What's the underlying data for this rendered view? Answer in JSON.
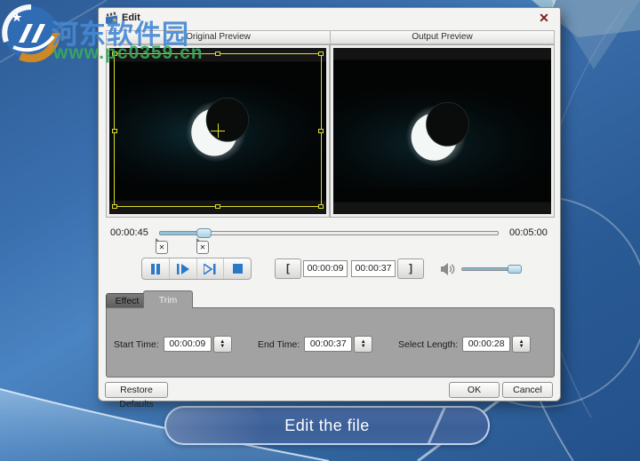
{
  "watermark": {
    "site_name": "河东软件园",
    "site_url": "www.pc0359.cn"
  },
  "dialog": {
    "title": "Edit",
    "panes": {
      "original_label": "Original Preview",
      "output_label": "Output Preview"
    },
    "timeline": {
      "current_time": "00:00:45",
      "total_time": "00:05:00",
      "progress_pct": 13
    },
    "volume": {
      "level_pct": 92
    },
    "trim": {
      "open_bracket": "[",
      "close_bracket": "]",
      "start_time": "00:00:09",
      "end_time": "00:00:37"
    },
    "tabs": [
      {
        "label": "Effect",
        "active": false
      },
      {
        "label": "Trim",
        "active": true
      }
    ],
    "form": {
      "start_label": "Start Time:",
      "start_value": "00:00:09",
      "end_label": "End Time:",
      "end_value": "00:00:37",
      "length_label": "Select Length:",
      "length_value": "00:00:28"
    },
    "footer": {
      "restore_label": "Restore Defaults",
      "ok_label": "OK",
      "cancel_label": "Cancel"
    }
  },
  "caption": {
    "text": "Edit the file"
  },
  "icons": {
    "close": "✕",
    "marker_x": "✕",
    "spinner_up": "▲",
    "spinner_down": "▼"
  },
  "colors": {
    "desktop_blue": "#3a6fae",
    "crop_yellow": "#dedc2e",
    "control_blue": "#2a79c8",
    "slider_fill": "#8ec2dd",
    "panel_gray": "#a2a2a2",
    "banner_blue": "#3c5f98"
  }
}
